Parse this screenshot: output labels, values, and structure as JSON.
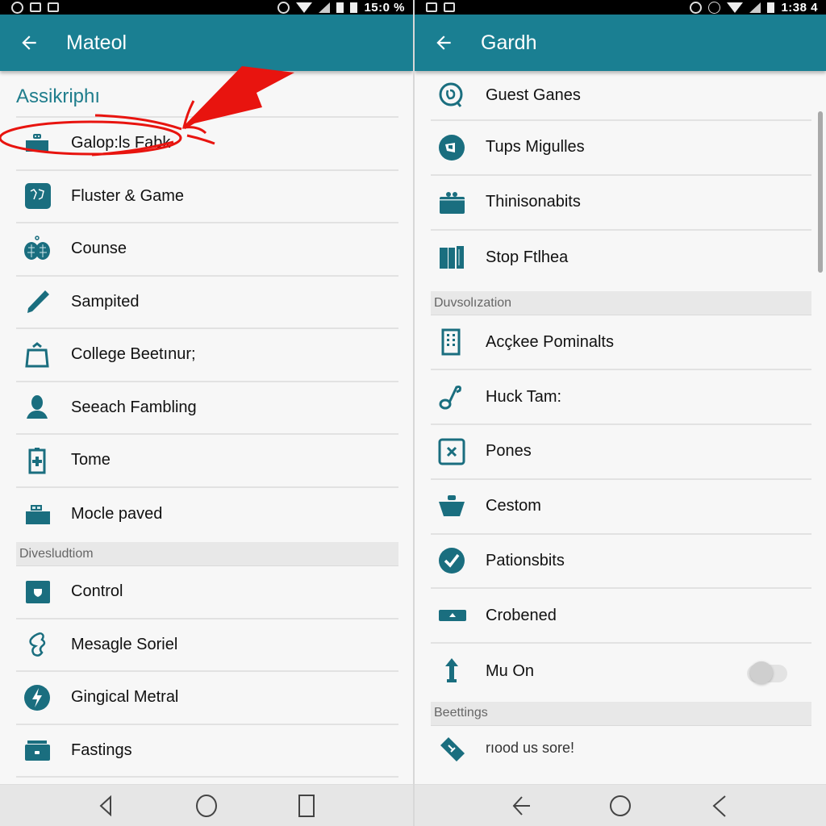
{
  "colors": {
    "appbar": "#1a7f92",
    "icon": "#1a6e7f",
    "section_header": "#1f7d8c",
    "annotation": "#e8140f"
  },
  "left": {
    "statusbar": {
      "left_icons": [
        "notification-icon",
        "image-icon",
        "screenshot-icon"
      ],
      "right_icons": [
        "sync-icon",
        "wifi-icon",
        "signal-icon",
        "battery-icon",
        "battery-icon"
      ],
      "time": "15:0 %"
    },
    "appbar": {
      "back_icon": "arrow-back-icon",
      "title": "Mateol"
    },
    "section_title": "Assikriphı",
    "items": [
      {
        "label": "Galop:ls Fabk",
        "icon": "robot-icon"
      },
      {
        "label": "Fluster & Game",
        "icon": "game-icon"
      },
      {
        "label": "Counse",
        "icon": "brain-icon"
      },
      {
        "label": "Sampited",
        "icon": "pencil-icon"
      },
      {
        "label": "College Beetınur;",
        "icon": "bag-icon"
      },
      {
        "label": "Seeach Fambling",
        "icon": "person-icon"
      },
      {
        "label": "Tome",
        "icon": "medical-icon"
      },
      {
        "label": "Mocle paved",
        "icon": "keyboard-icon"
      }
    ],
    "section2": "Divesludtiom",
    "items2": [
      {
        "label": "Control",
        "icon": "shield-icon"
      },
      {
        "label": "Mesagle Soriel",
        "icon": "squiggle-icon"
      },
      {
        "label": "Gingical Metral",
        "icon": "lightning-icon"
      },
      {
        "label": "Fastings",
        "icon": "drawer-icon"
      }
    ],
    "navbar": [
      "back-triangle-icon",
      "home-circle-icon",
      "recents-square-icon"
    ],
    "annotation": "red circle and arrow highlighting first item"
  },
  "right": {
    "statusbar": {
      "left_icons": [
        "image-icon",
        "screenshot-icon"
      ],
      "right_icons": [
        "sync-icon",
        "rotate-icon",
        "wifi-icon",
        "signal-icon",
        "battery-icon"
      ],
      "time": "1:38 4"
    },
    "appbar": {
      "back_icon": "arrow-back-icon",
      "title": "Gardh"
    },
    "items": [
      {
        "label": "Guest Ganes",
        "icon": "search-chat-icon"
      },
      {
        "label": "Tups Migulles",
        "icon": "circle-flag-icon"
      },
      {
        "label": "Thinisonabits",
        "icon": "gift-icon"
      },
      {
        "label": "Stop Ftlhea",
        "icon": "books-icon"
      }
    ],
    "section2": "Duvsolızation",
    "items2": [
      {
        "label": "Acçkee Pominalts",
        "icon": "keypad-icon"
      },
      {
        "label": "Huck Tam:",
        "icon": "music-note-icon"
      },
      {
        "label": "Pones",
        "icon": "close-box-icon"
      },
      {
        "label": "Cestom",
        "icon": "basket-icon"
      },
      {
        "label": "Pationsbits",
        "icon": "check-circle-icon"
      },
      {
        "label": "Crobened",
        "icon": "eject-icon"
      },
      {
        "label": "Mu On",
        "icon": "upload-arrow-icon",
        "toggle": false
      }
    ],
    "section3": "Beettings",
    "items3": [
      {
        "label": "rıood us sore!",
        "icon": "ticket-icon"
      }
    ],
    "navbar": [
      "arrow-back-icon",
      "home-circle-icon",
      "chevron-left-icon"
    ]
  }
}
